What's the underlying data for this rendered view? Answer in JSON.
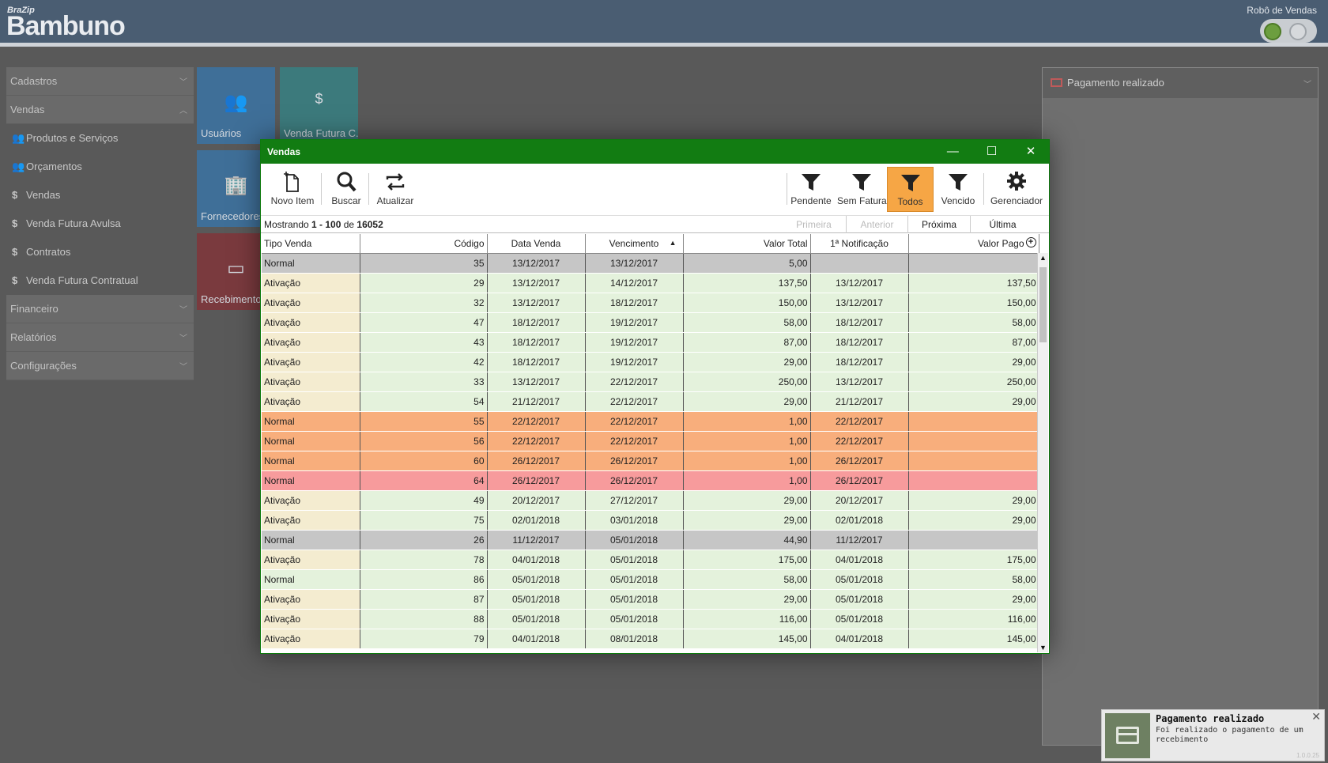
{
  "app": {
    "logo_small": "BraZip",
    "logo_big": "Bambuno",
    "robot_label": "Robô de Vendas"
  },
  "sidebar": {
    "sections": [
      {
        "label": "Cadastros"
      },
      {
        "label": "Vendas"
      },
      {
        "label": "Financeiro"
      },
      {
        "label": "Relatórios"
      },
      {
        "label": "Configurações"
      }
    ],
    "items": [
      {
        "label": "Produtos e Serviços",
        "icon": "people-icon"
      },
      {
        "label": "Orçamentos",
        "icon": "people-icon"
      },
      {
        "label": "Vendas",
        "icon": "dollar-icon"
      },
      {
        "label": "Venda Futura Avulsa",
        "icon": "dollar-icon"
      },
      {
        "label": "Contratos",
        "icon": "dollar-icon"
      },
      {
        "label": "Venda Futura Contratual",
        "icon": "dollar-icon"
      }
    ]
  },
  "tiles": [
    {
      "label": "Usuários",
      "color": "#3f6f98"
    },
    {
      "label": "Venda Futura C...",
      "color": "#3c7a7c"
    },
    {
      "label": "Fornecedores",
      "color": "#3f6f98"
    },
    {
      "label": "Recebimento",
      "color": "#7a3a3e"
    }
  ],
  "right_panel": {
    "title": "Pagamento realizado"
  },
  "toast": {
    "title": "Pagamento realizado",
    "body": "Foi realizado o pagamento de um recebimento",
    "version": "1.0.0.25"
  },
  "dialog": {
    "title": "Vendas",
    "toolbar": {
      "new": "Novo Item",
      "search": "Buscar",
      "refresh": "Atualizar",
      "f_pending": "Pendente",
      "f_noinvoice": "Sem Fatura",
      "f_all": "Todos",
      "f_overdue": "Vencido",
      "manager": "Gerenciador"
    },
    "pager": {
      "showing_prefix": "Mostrando ",
      "range": "1 - 100",
      "of": " de ",
      "total": "16052",
      "first": "Primeira",
      "prev": "Anterior",
      "next": "Próxima",
      "last": "Última"
    },
    "columns": [
      "Tipo Venda",
      "Código",
      "Data Venda",
      "Vencimento",
      "Valor Total",
      "1ª Notificação",
      "Valor Pago"
    ],
    "sort_indicator": "▲",
    "rows": [
      {
        "tipo": "Normal",
        "codigo": "35",
        "data": "13/12/2017",
        "venc": "13/12/2017",
        "total": "5,00",
        "notif": "",
        "pago": "",
        "status": "gray"
      },
      {
        "tipo": "Ativação",
        "codigo": "29",
        "data": "13/12/2017",
        "venc": "14/12/2017",
        "total": "137,50",
        "notif": "13/12/2017",
        "pago": "137,50",
        "status": "green"
      },
      {
        "tipo": "Ativação",
        "codigo": "32",
        "data": "13/12/2017",
        "venc": "18/12/2017",
        "total": "150,00",
        "notif": "13/12/2017",
        "pago": "150,00",
        "status": "green"
      },
      {
        "tipo": "Ativação",
        "codigo": "47",
        "data": "18/12/2017",
        "venc": "19/12/2017",
        "total": "58,00",
        "notif": "18/12/2017",
        "pago": "58,00",
        "status": "green"
      },
      {
        "tipo": "Ativação",
        "codigo": "43",
        "data": "18/12/2017",
        "venc": "19/12/2017",
        "total": "87,00",
        "notif": "18/12/2017",
        "pago": "87,00",
        "status": "green"
      },
      {
        "tipo": "Ativação",
        "codigo": "42",
        "data": "18/12/2017",
        "venc": "19/12/2017",
        "total": "29,00",
        "notif": "18/12/2017",
        "pago": "29,00",
        "status": "green"
      },
      {
        "tipo": "Ativação",
        "codigo": "33",
        "data": "13/12/2017",
        "venc": "22/12/2017",
        "total": "250,00",
        "notif": "13/12/2017",
        "pago": "250,00",
        "status": "green"
      },
      {
        "tipo": "Ativação",
        "codigo": "54",
        "data": "21/12/2017",
        "venc": "22/12/2017",
        "total": "29,00",
        "notif": "21/12/2017",
        "pago": "29,00",
        "status": "green"
      },
      {
        "tipo": "Normal",
        "codigo": "55",
        "data": "22/12/2017",
        "venc": "22/12/2017",
        "total": "1,00",
        "notif": "22/12/2017",
        "pago": "",
        "status": "orange"
      },
      {
        "tipo": "Normal",
        "codigo": "56",
        "data": "22/12/2017",
        "venc": "22/12/2017",
        "total": "1,00",
        "notif": "22/12/2017",
        "pago": "",
        "status": "orange"
      },
      {
        "tipo": "Normal",
        "codigo": "60",
        "data": "26/12/2017",
        "venc": "26/12/2017",
        "total": "1,00",
        "notif": "26/12/2017",
        "pago": "",
        "status": "orange"
      },
      {
        "tipo": "Normal",
        "codigo": "64",
        "data": "26/12/2017",
        "venc": "26/12/2017",
        "total": "1,00",
        "notif": "26/12/2017",
        "pago": "",
        "status": "red"
      },
      {
        "tipo": "Ativação",
        "codigo": "49",
        "data": "20/12/2017",
        "venc": "27/12/2017",
        "total": "29,00",
        "notif": "20/12/2017",
        "pago": "29,00",
        "status": "green"
      },
      {
        "tipo": "Ativação",
        "codigo": "75",
        "data": "02/01/2018",
        "venc": "03/01/2018",
        "total": "29,00",
        "notif": "02/01/2018",
        "pago": "29,00",
        "status": "green"
      },
      {
        "tipo": "Normal",
        "codigo": "26",
        "data": "11/12/2017",
        "venc": "05/01/2018",
        "total": "44,90",
        "notif": "11/12/2017",
        "pago": "",
        "status": "gray"
      },
      {
        "tipo": "Ativação",
        "codigo": "78",
        "data": "04/01/2018",
        "venc": "05/01/2018",
        "total": "175,00",
        "notif": "04/01/2018",
        "pago": "175,00",
        "status": "green"
      },
      {
        "tipo": "Normal",
        "codigo": "86",
        "data": "05/01/2018",
        "venc": "05/01/2018",
        "total": "58,00",
        "notif": "05/01/2018",
        "pago": "58,00",
        "status": "greenN"
      },
      {
        "tipo": "Ativação",
        "codigo": "87",
        "data": "05/01/2018",
        "venc": "05/01/2018",
        "total": "29,00",
        "notif": "05/01/2018",
        "pago": "29,00",
        "status": "green"
      },
      {
        "tipo": "Ativação",
        "codigo": "88",
        "data": "05/01/2018",
        "venc": "05/01/2018",
        "total": "116,00",
        "notif": "05/01/2018",
        "pago": "116,00",
        "status": "green"
      },
      {
        "tipo": "Ativação",
        "codigo": "79",
        "data": "04/01/2018",
        "venc": "08/01/2018",
        "total": "145,00",
        "notif": "04/01/2018",
        "pago": "145,00",
        "status": "green"
      }
    ]
  },
  "colors": {
    "header": "#4a5d72",
    "dialog_title": "#127c12",
    "row_green": "#e4f2dc",
    "row_green_first": "#f4ecd0",
    "row_orange": "#f8ae7c",
    "row_red": "#f79b9c",
    "row_gray": "#c6c6c6",
    "active_filter": "#f6a645"
  }
}
